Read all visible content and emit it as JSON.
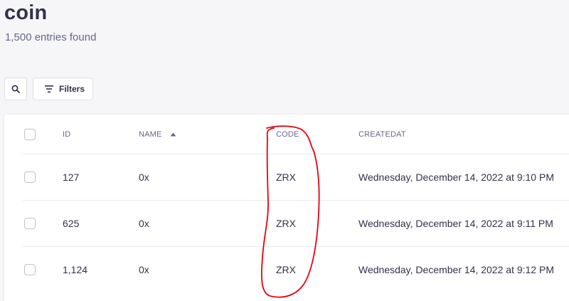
{
  "header": {
    "title": "coin",
    "subtitle": "1,500 entries found"
  },
  "toolbar": {
    "search_icon": "search-icon",
    "filters_label": "Filters",
    "filters_icon": "filter-icon"
  },
  "table": {
    "columns": {
      "id": "ID",
      "name": "NAME",
      "code": "CODE",
      "createdat": "CREATEDAT"
    },
    "sorted_column": "name",
    "sort_direction": "ascending",
    "rows": [
      {
        "id": "127",
        "name": "0x",
        "code": "ZRX",
        "createdat": "Wednesday, December 14, 2022 at 9:10 PM"
      },
      {
        "id": "625",
        "name": "0x",
        "code": "ZRX",
        "createdat": "Wednesday, December 14, 2022 at 9:11 PM"
      },
      {
        "id": "1,124",
        "name": "0x",
        "code": "ZRX",
        "createdat": "Wednesday, December 14, 2022 at 9:12 PM"
      }
    ]
  },
  "annotation": {
    "color": "#e8000e",
    "shape": "freehand-loop-around-code-column"
  },
  "colors": {
    "background": "#f6f6f9",
    "card": "#ffffff",
    "text": "#32324d",
    "muted": "#666687",
    "border": "#dcdce4",
    "accent": "#4945ff"
  }
}
